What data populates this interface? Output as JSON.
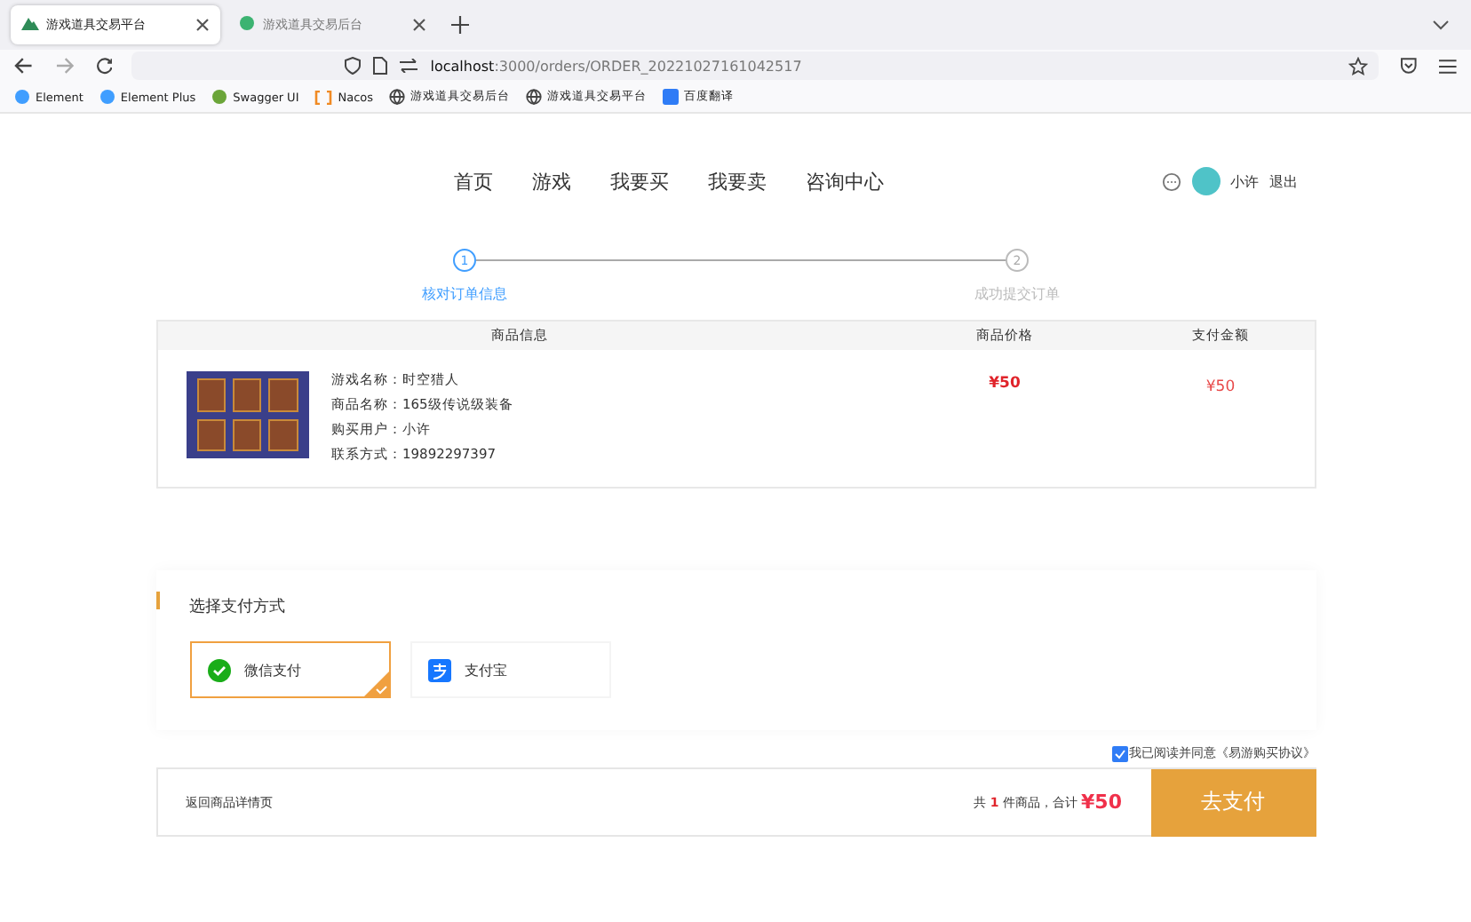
{
  "browser": {
    "tabs": [
      {
        "title": "游戏道具交易平台",
        "selected": true
      },
      {
        "title": "游戏道具交易后台",
        "selected": false
      }
    ],
    "url": {
      "host": "localhost",
      "path": ":3000/orders/ORDER_20221027161042517"
    },
    "bookmarks": [
      {
        "label": "Element",
        "kind": "element"
      },
      {
        "label": "Element Plus",
        "kind": "element"
      },
      {
        "label": "Swagger UI",
        "kind": "swagger"
      },
      {
        "label": "Nacos",
        "kind": "nacos"
      },
      {
        "label": "游戏道具交易后台",
        "kind": "globe"
      },
      {
        "label": "游戏道具交易平台",
        "kind": "globe"
      },
      {
        "label": "百度翻译",
        "kind": "baidu"
      }
    ]
  },
  "nav": {
    "items": [
      "首页",
      "游戏",
      "我要买",
      "我要卖",
      "咨询中心"
    ],
    "user": "小许",
    "logout": "退出"
  },
  "steps": [
    {
      "number": "1",
      "label": "核对订单信息",
      "selected": true
    },
    {
      "number": "2",
      "label": "成功提交订单",
      "selected": false
    }
  ],
  "order_table": {
    "columns": [
      "商品信息",
      "商品价格",
      "支付金额"
    ],
    "row": {
      "details": [
        {
          "label": "游戏名称：",
          "value": "时空猎人"
        },
        {
          "label": "商品名称：",
          "value": "165级传说级装备"
        },
        {
          "label": "购买用户：",
          "value": "小许"
        },
        {
          "label": "联系方式：",
          "value": "19892297397"
        }
      ],
      "price": "¥50",
      "amount": "¥50"
    }
  },
  "payment": {
    "title": "选择支付方式",
    "methods": [
      {
        "label": "微信支付",
        "kind": "wechat",
        "selected": true
      },
      {
        "label": "支付宝",
        "kind": "alipay",
        "selected": false
      }
    ]
  },
  "agreement": {
    "text": "我已阅读并同意《易游购买协议》",
    "checked": true
  },
  "footer": {
    "back_link": "返回商品详情页",
    "count_prefix": "共",
    "count": "1",
    "count_suffix": "件商品，合计",
    "total": "¥50",
    "pay_button": "去支付"
  }
}
